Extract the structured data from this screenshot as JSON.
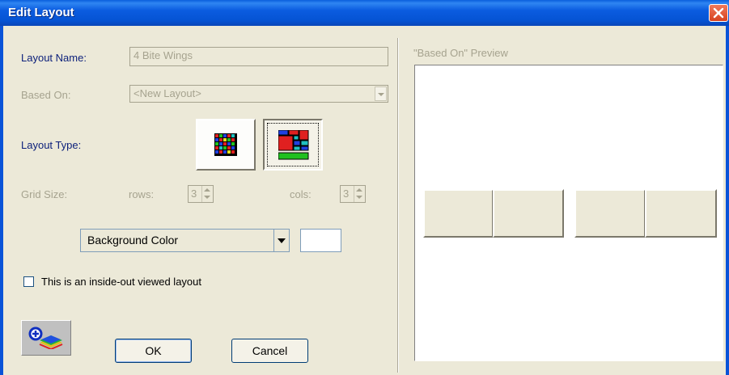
{
  "window": {
    "title": "Edit Layout"
  },
  "form": {
    "layout_name_label": "Layout Name:",
    "layout_name_value": "4 Bite Wings",
    "based_on_label": "Based On:",
    "based_on_value": "<New Layout>",
    "layout_type_label": "Layout Type:",
    "grid_size_label": "Grid Size:",
    "rows_label": "rows:",
    "rows_value": "3",
    "cols_label": "cols:",
    "cols_value": "3",
    "background_color_label": "Background Color",
    "background_color_value": "#ffffff",
    "inside_out_label": "This is an inside-out viewed layout",
    "inside_out_checked": false
  },
  "buttons": {
    "ok": "OK",
    "cancel": "Cancel"
  },
  "preview": {
    "label": "\"Based On\" Preview"
  },
  "icons": [
    "close-icon",
    "grid-layout-icon",
    "custom-layout-icon",
    "add-layout-icon"
  ]
}
